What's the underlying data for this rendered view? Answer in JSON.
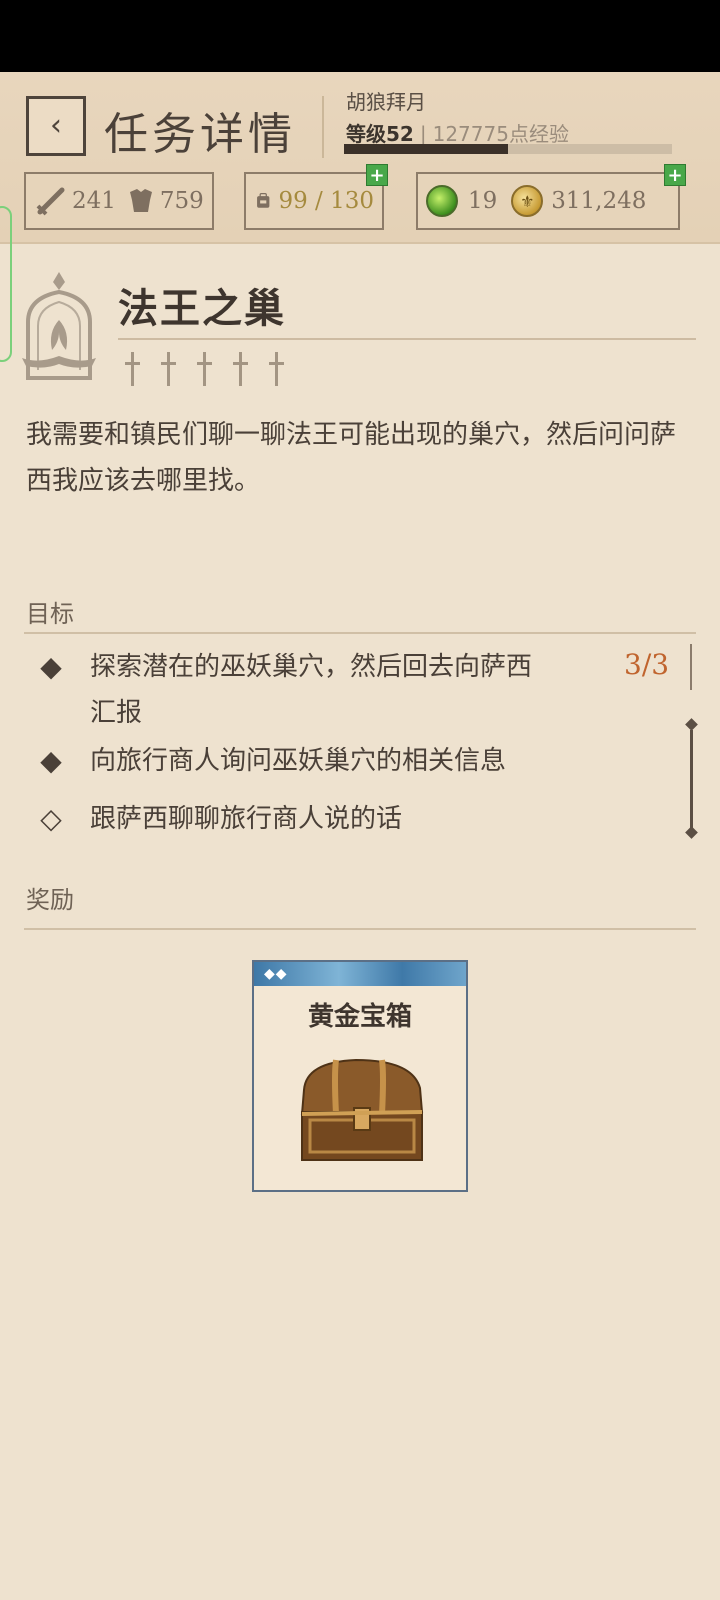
{
  "header": {
    "back_icon": "‹",
    "title": "任务详情",
    "player_name": "胡狼拜月",
    "level_label": "等级52",
    "exp_label": "127775点经验",
    "exp_progress": 0.5
  },
  "stats": {
    "attack": "241",
    "defense": "759",
    "capacity": "99 / 130",
    "gems": "19",
    "gold": "311,248",
    "plus": "+"
  },
  "quest": {
    "title": "法王之巢",
    "description": "我需要和镇民们聊一聊法王可能出现的巢穴，然后问问萨西我应该去哪里找。",
    "objectives_label": "目标",
    "objectives": [
      {
        "text": "探索潜在的巫妖巢穴，然后回去向萨西汇报",
        "done": true,
        "marker": "◆"
      },
      {
        "text": "向旅行商人询问巫妖巢穴的相关信息",
        "done": true,
        "marker": "◆"
      },
      {
        "text": "跟萨西聊聊旅行商人说的话",
        "done": false,
        "marker": "◇"
      }
    ],
    "objective_count": "3/3",
    "rewards_label": "奖励",
    "reward": {
      "rarity": "◆◆",
      "name": "黄金宝箱"
    }
  },
  "colors": {
    "background": "#eee2cf",
    "accent_orange": "#c0642e",
    "plus_green": "#49a84a"
  }
}
